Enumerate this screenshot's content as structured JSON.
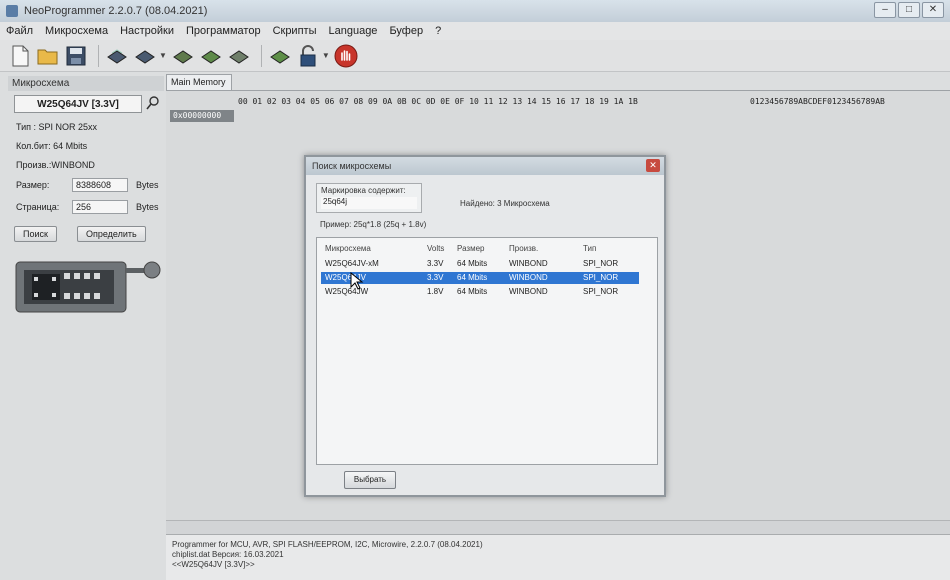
{
  "window": {
    "title": "NeoProgrammer 2.2.0.7 (08.04.2021)"
  },
  "window_controls": {
    "minimize": "–",
    "maximize": "□",
    "close": "✕"
  },
  "menu": [
    "Файл",
    "Микросхема",
    "Настройки",
    "Программатор",
    "Скрипты",
    "Language",
    "Буфер",
    "?"
  ],
  "left_panel": {
    "group_title": "Микросхема",
    "chip_name": "W25Q64JV [3.3V]",
    "type_line": "Тип   : SPI NOR 25xx",
    "size_line": "Кол.бит: 64 Mbits",
    "manuf_line": "Произв.:WINBOND",
    "size_label": "Размер:",
    "size_value": "8388608",
    "size_unit": "Bytes",
    "page_label": "Страница:",
    "page_value": "256",
    "page_unit": "Bytes",
    "search_button": "Поиск",
    "detect_button": "Определить"
  },
  "main": {
    "tab_label": "Main Memory",
    "hex_header": "00 01 02 03 04 05 06 07 08 09 0A 0B 0C 0D 0E 0F 10 11 12 13 14 15 16 17 18 19 1A 1B",
    "ascii_header": "0123456789ABCDEF0123456789AB",
    "first_address": "0x00000000"
  },
  "log": {
    "lines": [
      "Programmer for MCU, AVR, SPI FLASH/EEPROM, I2C, Microwire, 2.2.0.7 (08.04.2021)",
      "chiplist.dat Версия: 16.03.2021",
      "<<W25Q64JV [3.3V]>>"
    ]
  },
  "dialog": {
    "title": "Поиск микросхемы",
    "close": "✕",
    "mask_label": "Маркировка содержит:",
    "mask_value": "25q64j",
    "found_text": "Найдено: 3 Микросхема",
    "example_text": "Пример:  25q*1.8 (25q + 1.8v)",
    "columns": [
      "Микросхема",
      "Volts",
      "Размер",
      "Произв.",
      "Тип"
    ],
    "rows": [
      [
        "W25Q64JV-xM",
        "3.3V",
        "64 Mbits",
        "WINBOND",
        "SPI_NOR"
      ],
      [
        "W25Q64JV",
        "3.3V",
        "64 Mbits",
        "WINBOND",
        "SPI_NOR"
      ],
      [
        "W25Q64JW",
        "1.8V",
        "64 Mbits",
        "WINBOND",
        "SPI_NOR"
      ]
    ],
    "selected_row": 1,
    "select_button": "Выбрать"
  },
  "colors": {
    "selection": "#2f76d2",
    "address_bg": "#7f8488",
    "stop_red": "#c8352b"
  }
}
